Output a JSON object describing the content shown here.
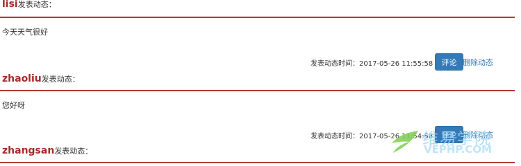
{
  "posts": [
    {
      "author": "lisi",
      "after_author": "发表动态：",
      "content": "今天天气很好",
      "time_label": "发表动态时间：",
      "time": "2017-05-26 11:55:58",
      "comment_label": "评论",
      "delete_label": "删除动态"
    },
    {
      "author": "zhaoliu",
      "after_author": "发表动态：",
      "content": "您好呀",
      "time_label": "发表动态时间：",
      "time": "2017-05-26 11:54:58",
      "comment_label": "评论",
      "delete_label": "删除动态"
    },
    {
      "author": "zhangsan",
      "after_author": "发表动态："
    }
  ],
  "watermark": {
    "title": "维易学院",
    "subtitle": "VEPHP.COM",
    "colors": {
      "leaf": "#7ccf4e",
      "text": "#9fd8f5"
    }
  },
  "colors": {
    "author": "#a52a2a",
    "separator": "#b03a3a",
    "button": "#337ab7",
    "link": "#337ab7"
  }
}
